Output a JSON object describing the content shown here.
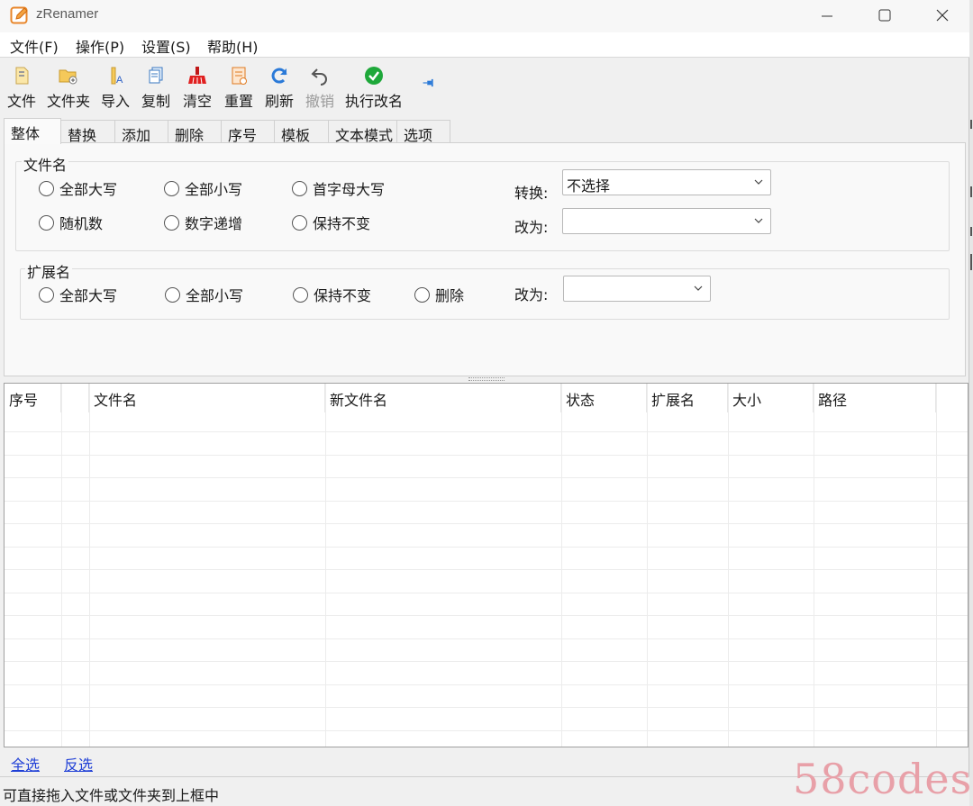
{
  "window": {
    "title": "zRenamer"
  },
  "menu": [
    {
      "label": "文件(F)"
    },
    {
      "label": "操作(P)"
    },
    {
      "label": "设置(S)"
    },
    {
      "label": "帮助(H)"
    }
  ],
  "toolbar": [
    {
      "label": "文件",
      "icon": "add-file-icon"
    },
    {
      "label": "文件夹",
      "icon": "add-folder-icon"
    },
    {
      "label": "导入",
      "icon": "import-icon"
    },
    {
      "label": "复制",
      "icon": "copy-icon"
    },
    {
      "label": "清空",
      "icon": "clear-icon"
    },
    {
      "label": "重置",
      "icon": "reset-icon"
    },
    {
      "label": "刷新",
      "icon": "refresh-icon"
    },
    {
      "label": "撤销",
      "icon": "undo-icon",
      "disabled": true
    },
    {
      "label": "执行改名",
      "icon": "execute-check-icon"
    }
  ],
  "tabs": [
    {
      "label": "整体",
      "active": true
    },
    {
      "label": "替换"
    },
    {
      "label": "添加"
    },
    {
      "label": "删除"
    },
    {
      "label": "序号"
    },
    {
      "label": "模板"
    },
    {
      "label": "文本模式"
    },
    {
      "label": "选项"
    }
  ],
  "filename_group": {
    "title": "文件名",
    "options": [
      "全部大写",
      "全部小写",
      "首字母大写",
      "随机数",
      "数字递增",
      "保持不变"
    ],
    "convert_label": "转换:",
    "convert_value": "不选择",
    "change_label": "改为:",
    "change_value": ""
  },
  "ext_group": {
    "title": "扩展名",
    "options": [
      "全部大写",
      "全部小写",
      "保持不变",
      "删除"
    ],
    "change_label": "改为:",
    "change_value": ""
  },
  "grid": {
    "columns": [
      "序号",
      "",
      "文件名",
      "新文件名",
      "状态",
      "扩展名",
      "大小",
      "路径"
    ]
  },
  "links": {
    "select_all": "全选",
    "invert": "反选"
  },
  "status": {
    "text": "可直接拖入文件或文件夹到上框中"
  },
  "watermark": "58codes",
  "colors": {
    "link": "#1f3fd6",
    "execute": "#1ea83a",
    "refresh": "#2b7ad8",
    "clear": "#e02020"
  }
}
